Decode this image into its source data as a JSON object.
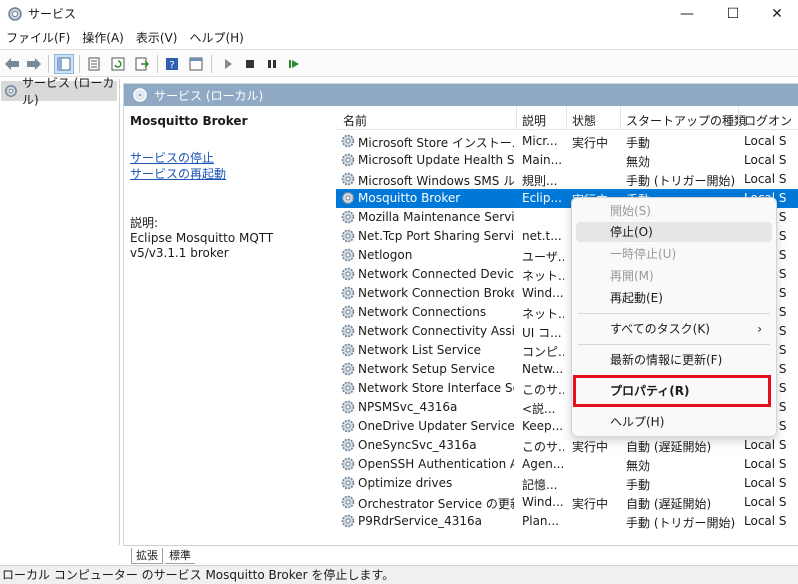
{
  "window": {
    "title": "サービス",
    "min": "—",
    "max": "☐",
    "close": "✕"
  },
  "menu": [
    "ファイル(F)",
    "操作(A)",
    "表示(V)",
    "ヘルプ(H)"
  ],
  "tree": {
    "root_label": "サービス (ローカル)"
  },
  "pane_header": "サービス (ローカル)",
  "details": {
    "service_name": "Mosquitto Broker",
    "link_stop": "サービスの停止",
    "link_restart": "サービスの再起動",
    "desc_label": "説明:",
    "desc_text": "Eclipse Mosquitto MQTT v5/v3.1.1 broker"
  },
  "columns": [
    "名前",
    "説明",
    "状態",
    "スタートアップの種類",
    "ログオン"
  ],
  "rows": [
    {
      "name": "Microsoft Store インストール ...",
      "desc": "Micr...",
      "state": "実行中",
      "startup": "手動",
      "logon": "Local S"
    },
    {
      "name": "Microsoft Update Health Se...",
      "desc": "Main...",
      "state": "",
      "startup": "無効",
      "logon": "Local S"
    },
    {
      "name": "Microsoft Windows SMS ル...",
      "desc": "規則...",
      "state": "",
      "startup": "手動 (トリガー開始)",
      "logon": "Local S"
    },
    {
      "name": "Mosquitto Broker",
      "desc": "Eclip...",
      "state": "実行中",
      "startup": "手動",
      "logon": "Local S"
    },
    {
      "name": "Mozilla Maintenance Service",
      "desc": "",
      "state": "",
      "startup": "",
      "logon": "Local S"
    },
    {
      "name": "Net.Tcp Port Sharing Service",
      "desc": "net.t...",
      "state": "",
      "startup": "",
      "logon": "Local S"
    },
    {
      "name": "Netlogon",
      "desc": "ユーザ...",
      "state": "",
      "startup": "",
      "logon": "Local S"
    },
    {
      "name": "Network Connected Device...",
      "desc": "ネット...",
      "state": "",
      "startup": "",
      "logon": "Local S"
    },
    {
      "name": "Network Connection Broker",
      "desc": "Wind...",
      "state": "",
      "startup": "",
      "logon": "Local S"
    },
    {
      "name": "Network Connections",
      "desc": "ネット...",
      "state": "",
      "startup": "",
      "logon": "Local S"
    },
    {
      "name": "Network Connectivity Assist...",
      "desc": "UI コ...",
      "state": "",
      "startup": "",
      "logon": "Local S"
    },
    {
      "name": "Network List Service",
      "desc": "コンピ...",
      "state": "",
      "startup": "",
      "logon": "Local S"
    },
    {
      "name": "Network Setup Service",
      "desc": "Netw...",
      "state": "",
      "startup": "",
      "logon": "Local S"
    },
    {
      "name": "Network Store Interface Ser...",
      "desc": "このサ...",
      "state": "",
      "startup": "",
      "logon": "Local S"
    },
    {
      "name": "NPSMSvc_4316a",
      "desc": "<説...",
      "state": "",
      "startup": "",
      "logon": "Local S"
    },
    {
      "name": "OneDrive Updater Service",
      "desc": "Keep...",
      "state": "",
      "startup": "",
      "logon": "Local S"
    },
    {
      "name": "OneSyncSvc_4316a",
      "desc": "このサ...",
      "state": "実行中",
      "startup": "自動 (遅延開始)",
      "logon": "Local S"
    },
    {
      "name": "OpenSSH Authentication A...",
      "desc": "Agen...",
      "state": "",
      "startup": "無効",
      "logon": "Local S"
    },
    {
      "name": "Optimize drives",
      "desc": "記憶...",
      "state": "",
      "startup": "手動",
      "logon": "Local S"
    },
    {
      "name": "Orchestrator Service の更新",
      "desc": "Wind...",
      "state": "実行中",
      "startup": "自動 (遅延開始)",
      "logon": "Local S"
    },
    {
      "name": "P9RdrService_4316a",
      "desc": "Plan...",
      "state": "",
      "startup": "手動 (トリガー開始)",
      "logon": "Local S"
    }
  ],
  "context_menu": {
    "start": "開始(S)",
    "stop": "停止(O)",
    "pause": "一時停止(U)",
    "resume": "再開(M)",
    "restart": "再起動(E)",
    "all_tasks": "すべてのタスク(K)",
    "refresh": "最新の情報に更新(F)",
    "properties": "プロパティ(R)",
    "help": "ヘルプ(H)"
  },
  "tabs": [
    "拡張",
    "標準"
  ],
  "status_text": "ローカル コンピューター のサービス Mosquitto Broker を停止します。",
  "colors": {
    "selection": "#0078d7",
    "pane_header": "#8fa8c4",
    "highlight_box": "#e5101d",
    "link": "#1a55b6"
  }
}
